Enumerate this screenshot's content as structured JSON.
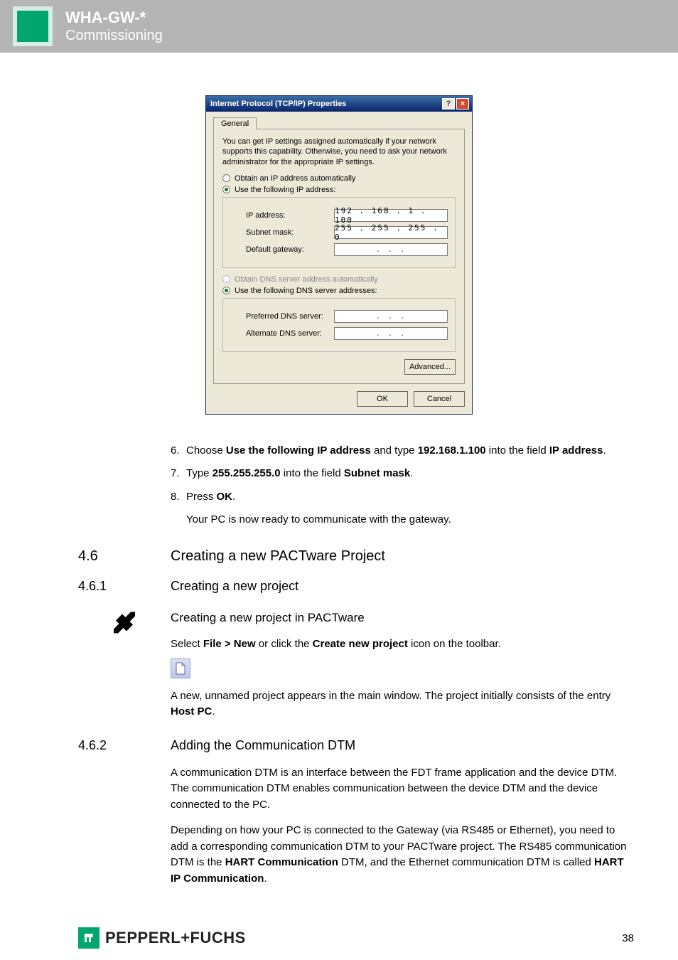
{
  "header": {
    "title": "WHA-GW-*",
    "subtitle": "Commissioning"
  },
  "dialog": {
    "title": "Internet Protocol (TCP/IP) Properties",
    "tab": "General",
    "desc": "You can get IP settings assigned automatically if your network supports this capability. Otherwise, you need to ask your network administrator for the appropriate IP settings.",
    "radio_auto_ip": "Obtain an IP address automatically",
    "radio_use_ip": "Use the following IP address:",
    "label_ip": "IP address:",
    "value_ip": "192 . 168 .   1 . 100",
    "label_mask": "Subnet mask:",
    "value_mask": "255 . 255 . 255 .   0",
    "label_gateway": "Default gateway:",
    "value_gateway": ".       .       .",
    "radio_auto_dns": "Obtain DNS server address automatically",
    "radio_use_dns": "Use the following DNS server addresses:",
    "label_pref_dns": "Preferred DNS server:",
    "value_pref_dns": ".       .       .",
    "label_alt_dns": "Alternate DNS server:",
    "value_alt_dns": ".       .       .",
    "btn_adv": "Advanced...",
    "btn_ok": "OK",
    "btn_cancel": "Cancel"
  },
  "steps": {
    "n6": "6.",
    "s6a": "Choose ",
    "s6b": "Use the following IP address",
    "s6c": " and type ",
    "s6d": "192.168.1.100",
    "s6e": " into the field ",
    "s6f": "IP address",
    "s6g": ".",
    "n7": "7.",
    "s7a": "Type ",
    "s7b": "255.255.255.0",
    "s7c": " into the field ",
    "s7d": "Subnet mask",
    "s7e": ".",
    "n8": "8.",
    "s8a": "Press ",
    "s8b": "OK",
    "s8c": ".",
    "s8_res": "Your PC is now ready to communicate with the gateway."
  },
  "sections": {
    "h46_num": "4.6",
    "h46": "Creating a new PACTware Project",
    "h461_num": "4.6.1",
    "h461": "Creating a new project",
    "tool_title": "Creating a new project in PACTware",
    "tool_p_a": "Select ",
    "tool_p_b": "File > New",
    "tool_p_c": " or click the ",
    "tool_p_d": "Create new project",
    "tool_p_e": " icon on the toolbar.",
    "tool_res_a": "A new, unnamed project appears in the main window. The project initially consists of the entry ",
    "tool_res_b": "Host PC",
    "tool_res_c": ".",
    "h462_num": "4.6.2",
    "h462": "Adding the Communication DTM",
    "p462a": "A communication DTM is an interface between the FDT frame application and the device DTM. The communication DTM enables communication between the device DTM and the device connected to the PC.",
    "p462b_a": "Depending on how your PC is connected to the Gateway (via RS485 or Ethernet), you need to add a corresponding communication DTM to your PACTware project. The RS485 communication DTM is the ",
    "p462b_b": "HART Communication",
    "p462b_c": " DTM, and the Ethernet communication DTM is called ",
    "p462b_d": "HART IP Communication",
    "p462b_e": "."
  },
  "footer": {
    "brand": "PEPPERL+FUCHS",
    "page": "38"
  }
}
